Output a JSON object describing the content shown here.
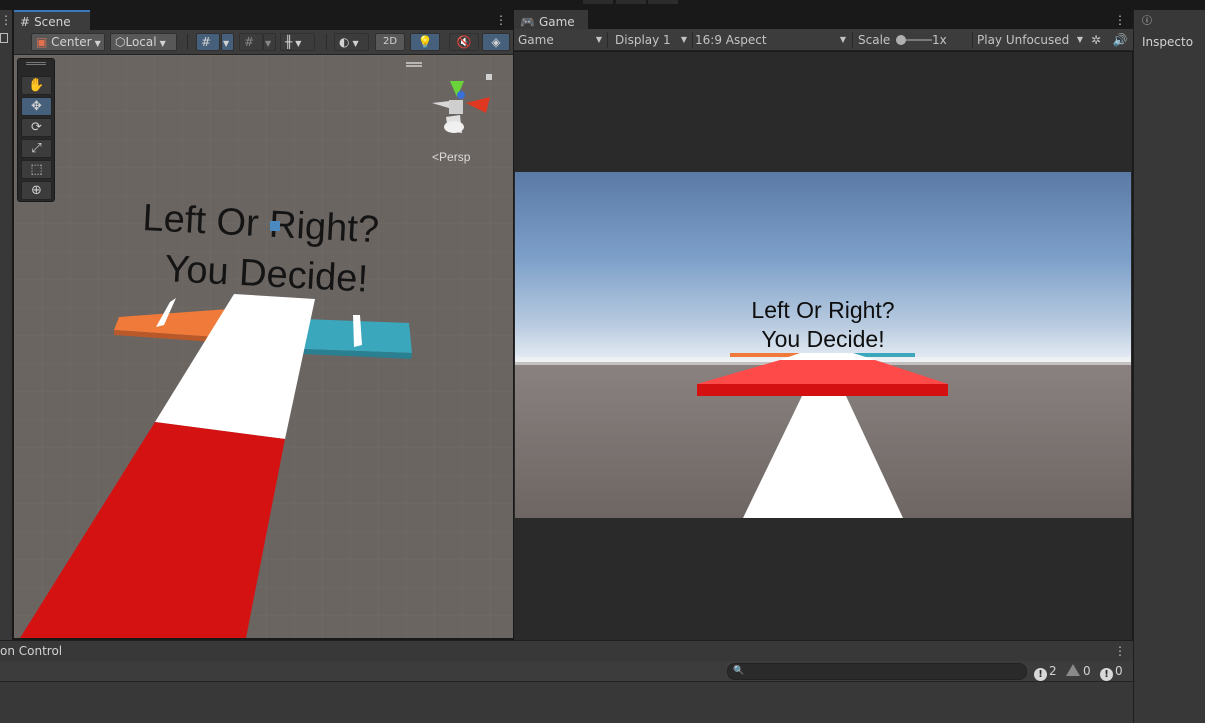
{
  "scene_tab": {
    "label": "Scene"
  },
  "game_tab": {
    "label": "Game"
  },
  "inspector_tab": {
    "label": "Inspecto"
  },
  "bottom_tab": {
    "label": "on Control"
  },
  "scene_toolbar": {
    "pivot": "Center",
    "space": "Local",
    "mode_2d": "2D"
  },
  "gizmo": {
    "projection": "Persp"
  },
  "game_toolbar": {
    "view": "Game",
    "display": "Display 1",
    "aspect": "16:9 Aspect",
    "scale_label": "Scale",
    "scale_value": "1x",
    "play_mode": "Play Unfocused"
  },
  "scene_text": {
    "line1": "Left Or Right?",
    "line2": "You Decide!"
  },
  "game_text": {
    "line1": "Left Or Right?",
    "line2": "You Decide!"
  },
  "console": {
    "search_placeholder": "",
    "error_count": "2",
    "warning_count": "0",
    "info_count": "0"
  },
  "colors": {
    "accent": "#3a79bb",
    "panel": "#3c3c3c",
    "scene_ground": "#6b6562",
    "road_red": "#d41212",
    "platform_orange": "#f07a3a",
    "platform_teal": "#3aa7bd"
  }
}
